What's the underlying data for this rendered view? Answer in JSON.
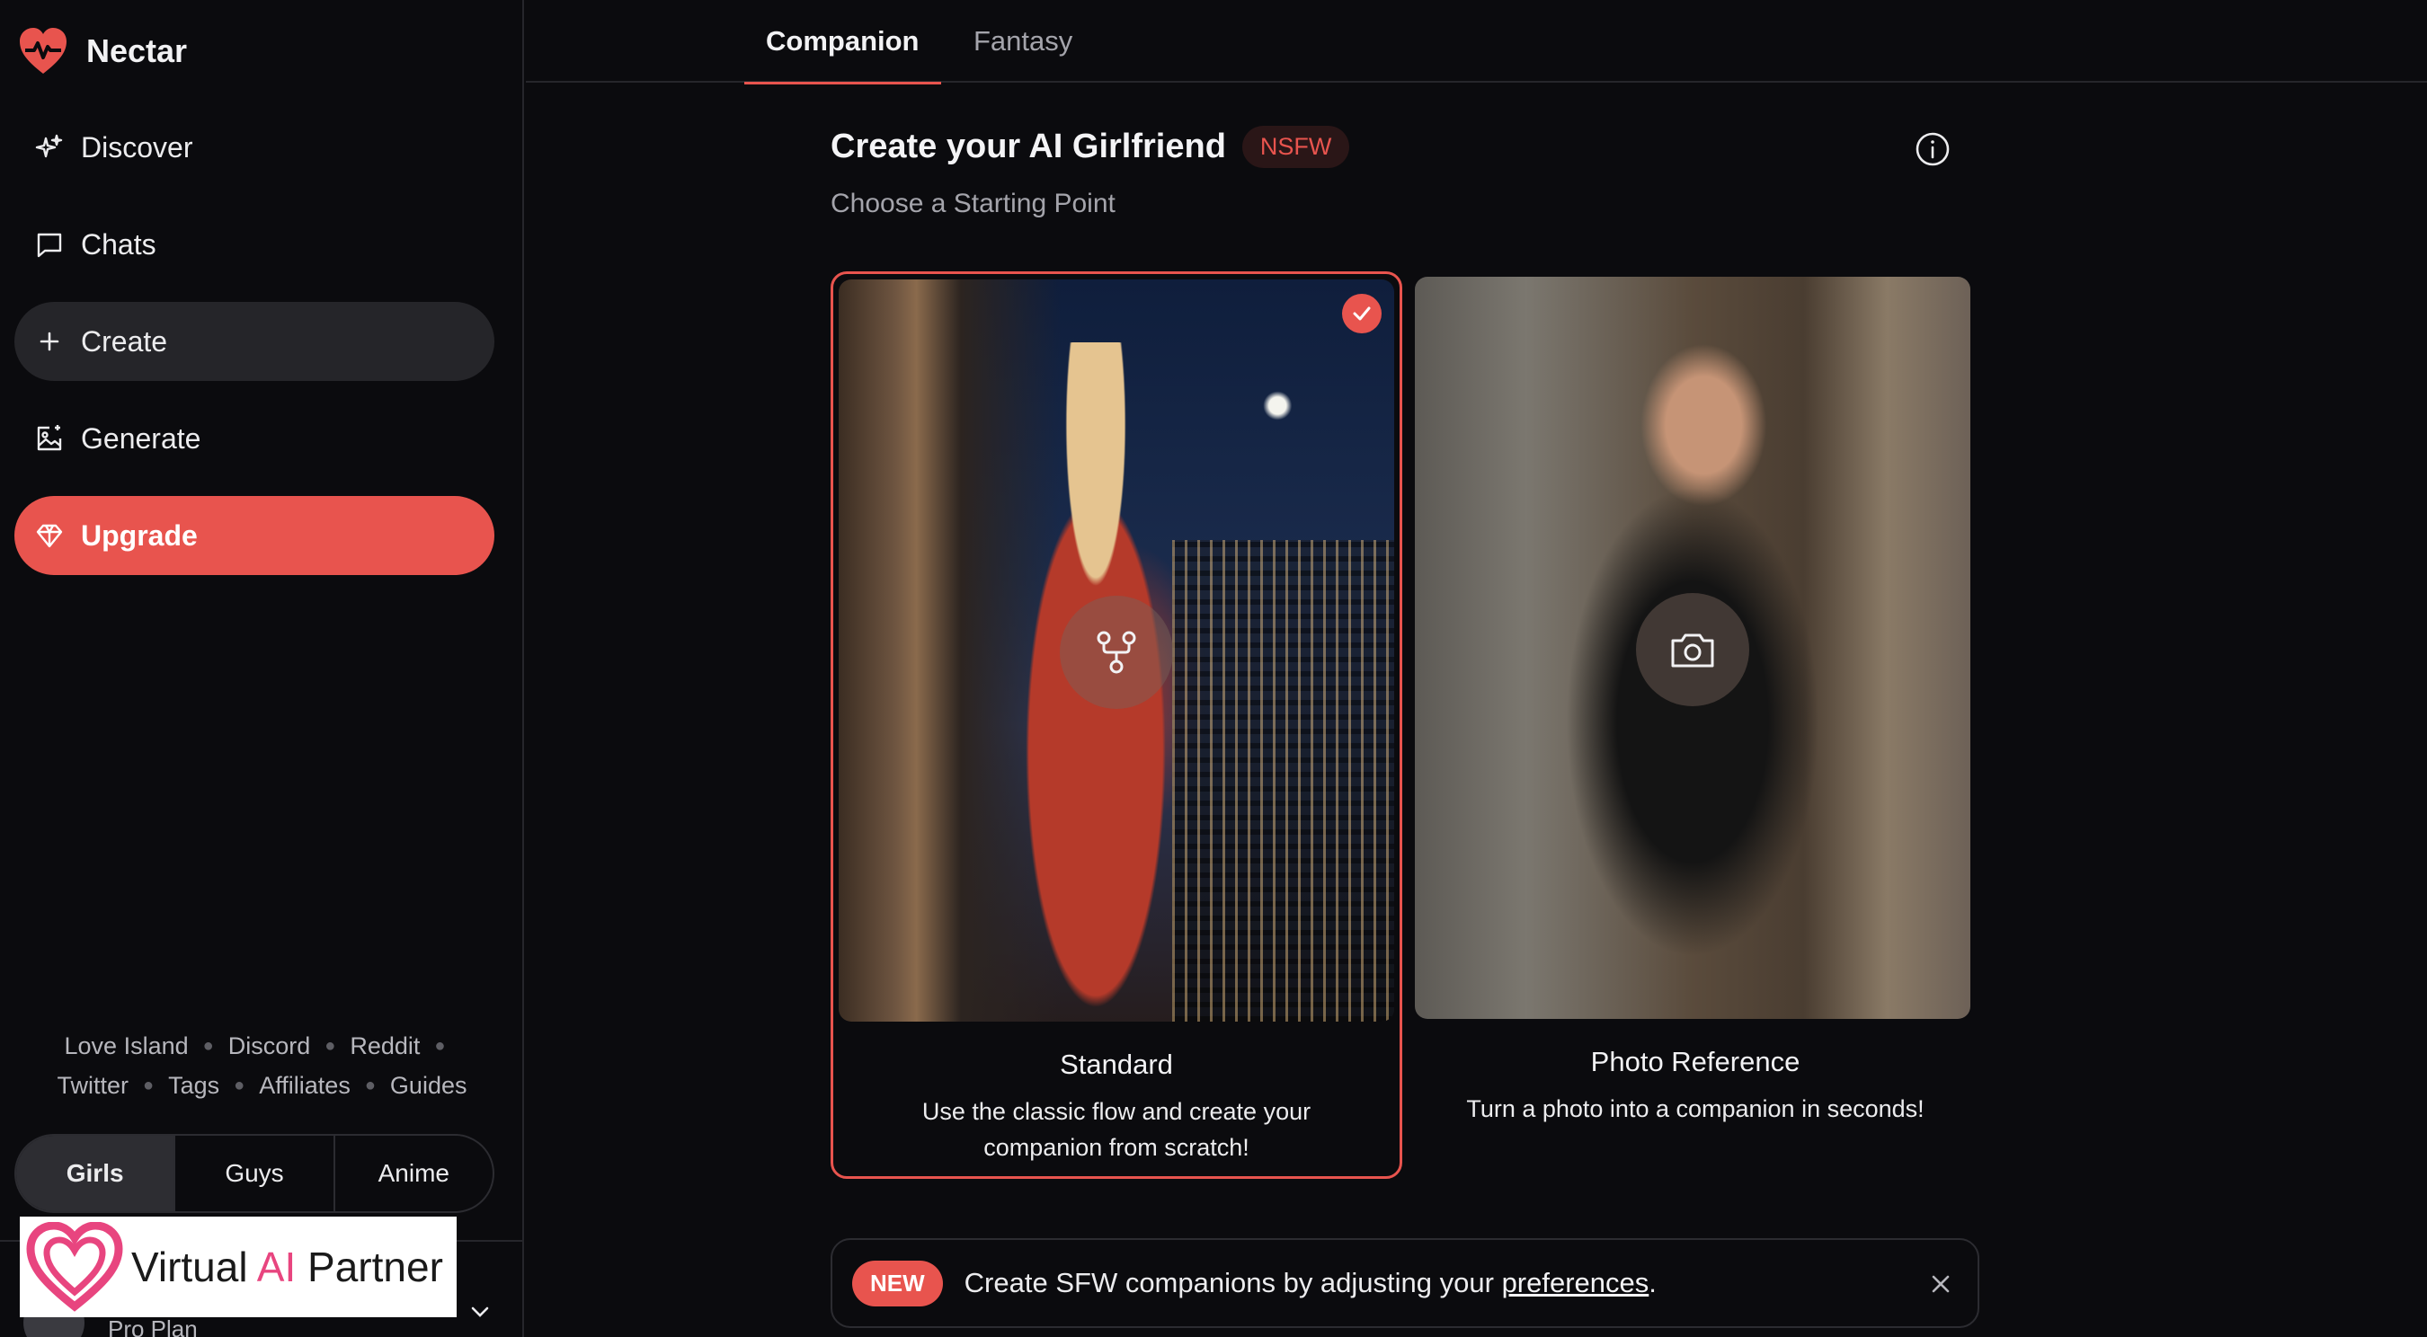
{
  "brand": {
    "name": "Nectar",
    "accent": "#e8544e"
  },
  "nav": [
    {
      "label": "Discover",
      "icon": "sparkles-icon"
    },
    {
      "label": "Chats",
      "icon": "chat-bubble-icon"
    },
    {
      "label": "Create",
      "icon": "plus-icon"
    },
    {
      "label": "Generate",
      "icon": "image-edit-icon"
    },
    {
      "label": "Upgrade",
      "icon": "diamond-icon"
    }
  ],
  "footer_links": {
    "row1": [
      "Love Island",
      "Discord",
      "Reddit"
    ],
    "row2": [
      "Twitter",
      "Tags",
      "Affiliates",
      "Guides"
    ]
  },
  "segment": [
    "Girls",
    "Guys",
    "Anime"
  ],
  "account": {
    "plan": "Pro Plan"
  },
  "watermark": {
    "text_a": "Virtual ",
    "text_b": "AI",
    "text_c": " Partner"
  },
  "tabs": [
    "Companion",
    "Fantasy"
  ],
  "main": {
    "title": "Create your AI Girlfriend",
    "badge": "NSFW",
    "subtitle": "Choose a Starting Point"
  },
  "cards": [
    {
      "title": "Standard",
      "desc": "Use the classic flow and create your companion from scratch!",
      "icon": "flow-icon",
      "selected": true
    },
    {
      "title": "Photo Reference",
      "desc": "Turn a photo into a companion in seconds!",
      "icon": "camera-icon",
      "selected": false
    }
  ],
  "banner": {
    "pill": "NEW",
    "text": "Create SFW companions by adjusting your ",
    "link": "preferences",
    "after": "."
  }
}
